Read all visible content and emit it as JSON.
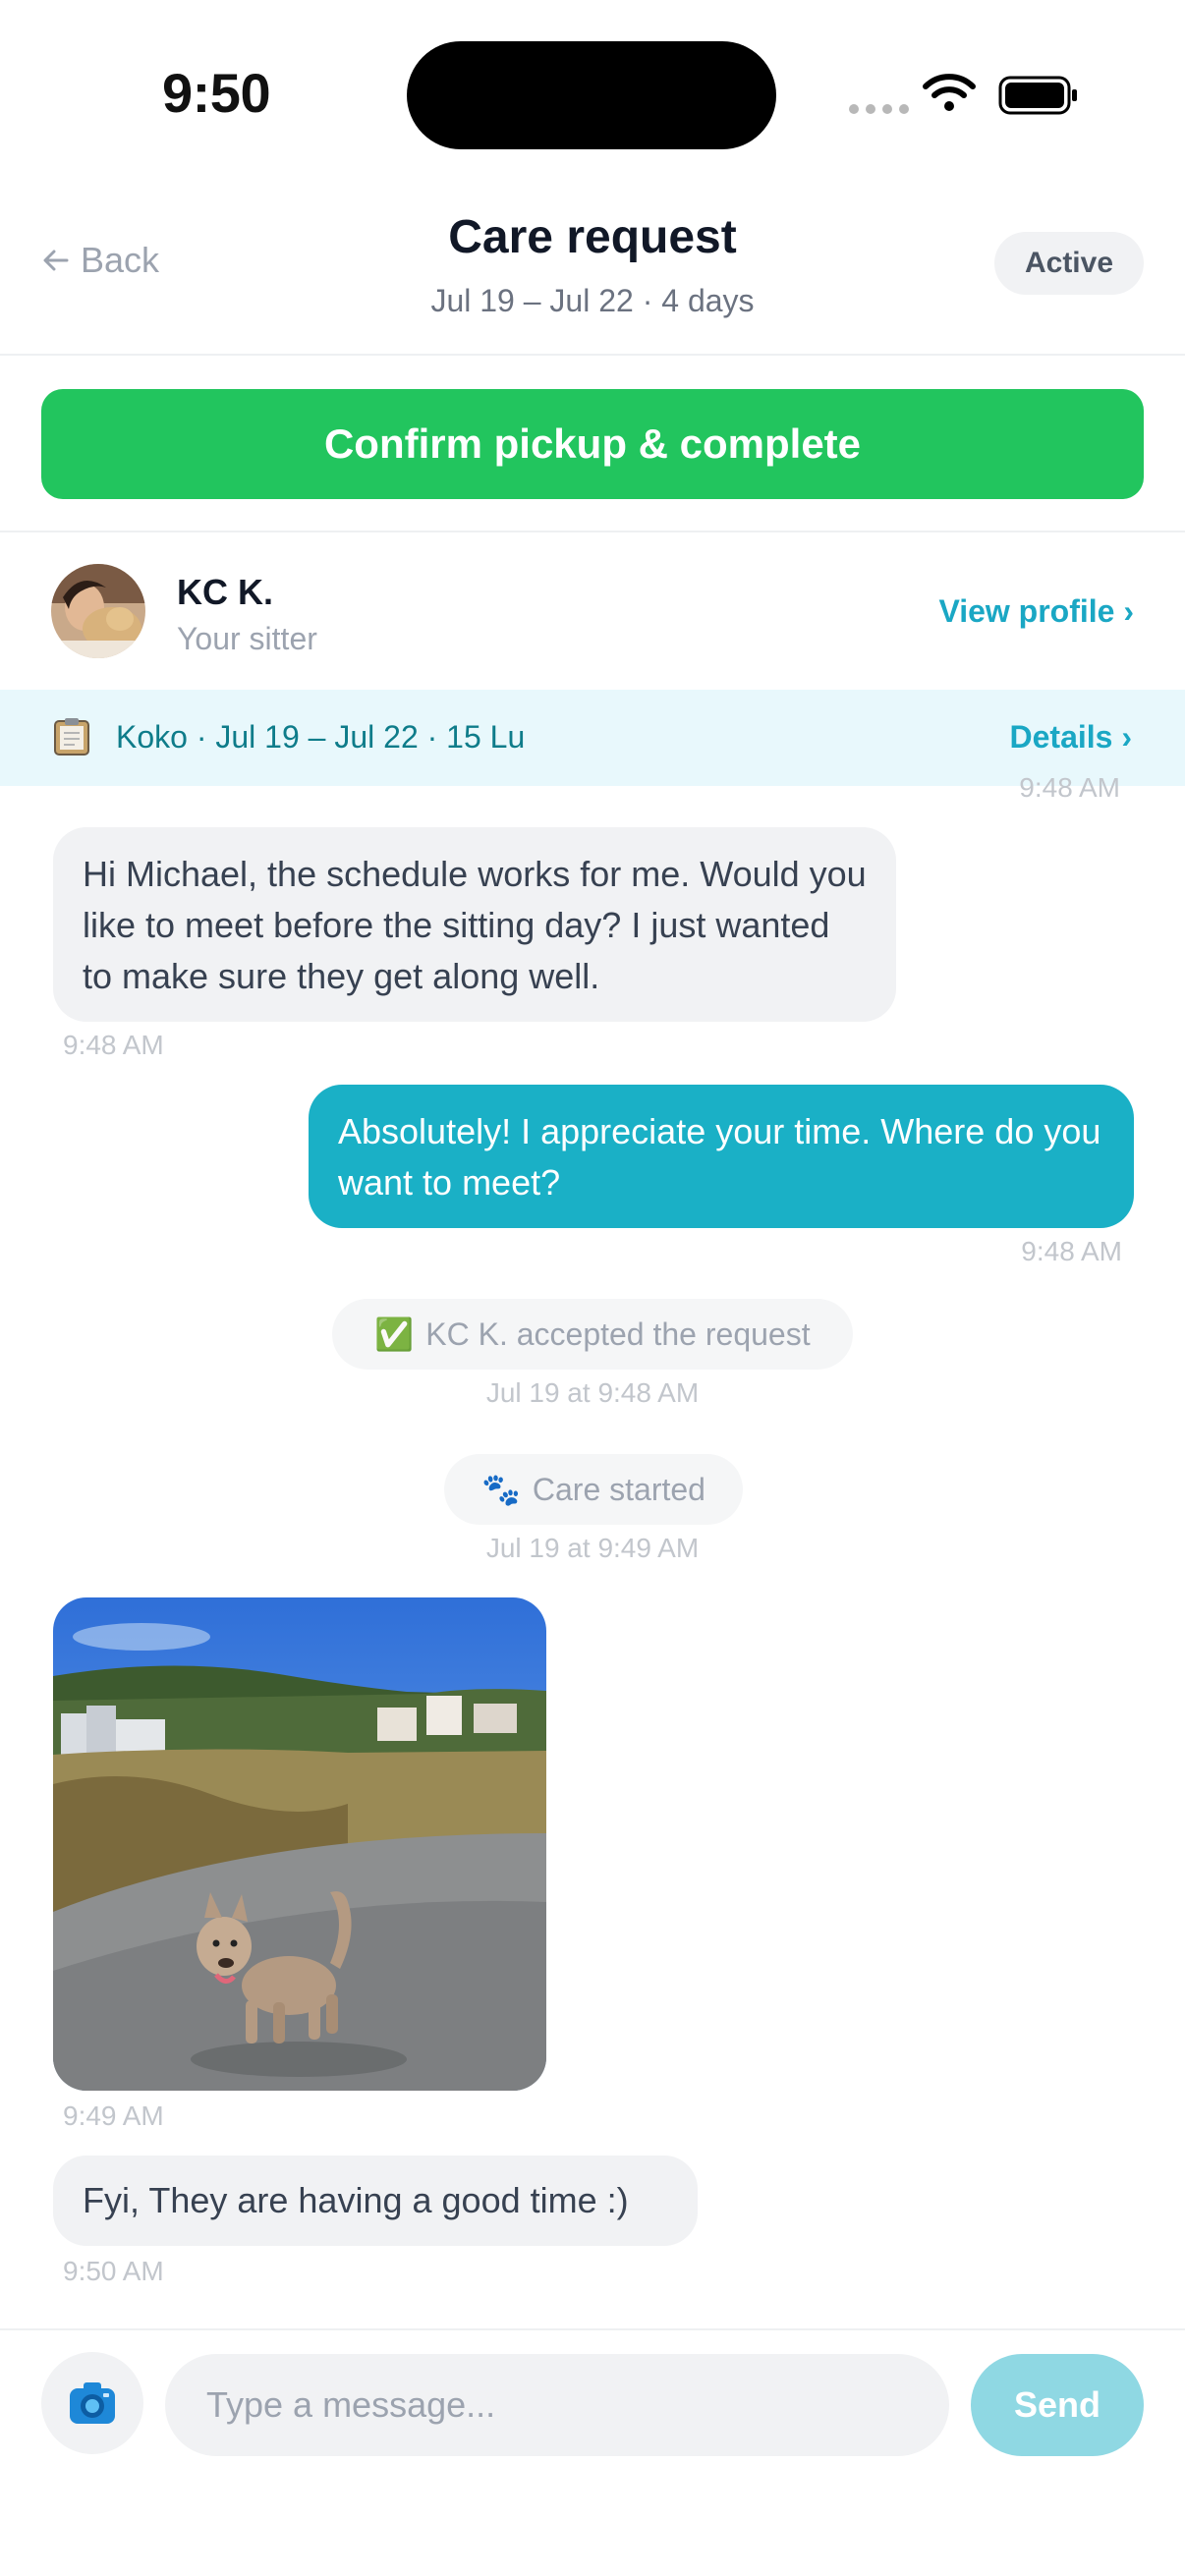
{
  "status_bar": {
    "time": "9:50"
  },
  "header": {
    "back_label": "Back",
    "title": "Care request",
    "subtitle": "Jul 19 – Jul 22 · 4 days",
    "status_badge": "Active"
  },
  "primary_action": {
    "label": "Confirm pickup & complete"
  },
  "sitter": {
    "name": "KC K.",
    "role": "Your sitter",
    "view_profile": "View profile ›"
  },
  "booking": {
    "summary": "Koko · Jul 19 – Jul 22 · 15 Lu",
    "details_link": "Details ›"
  },
  "messages": {
    "partial_time": "9:48 AM",
    "m1": {
      "text": "Hi Michael, the schedule works for me. Would you like to meet before the sitting day? I just wanted to make sure they get along well.",
      "time": "9:48 AM"
    },
    "m2": {
      "text": "Absolutely! I appreciate your time. Where do you want to meet?",
      "time": "9:48 AM"
    },
    "sys1": {
      "icon": "✅",
      "text": "KC K. accepted the request",
      "time": "Jul 19 at 9:48 AM"
    },
    "sys2": {
      "icon": "🐾",
      "text": "Care started",
      "time": "Jul 19 at 9:49 AM"
    },
    "photo": {
      "time": "9:49 AM"
    },
    "m4": {
      "text": "Fyi, They are having a good time :)",
      "time": "9:50 AM"
    }
  },
  "composer": {
    "placeholder": "Type a message...",
    "send_label": "Send"
  },
  "colors": {
    "accent": "#1ab0c6",
    "cta_green": "#22c55e",
    "band_bg": "#e8f8fc"
  },
  "icons": {
    "back": "arrow-left-icon",
    "camera": "camera-icon",
    "booking": "clipboard-icon"
  }
}
